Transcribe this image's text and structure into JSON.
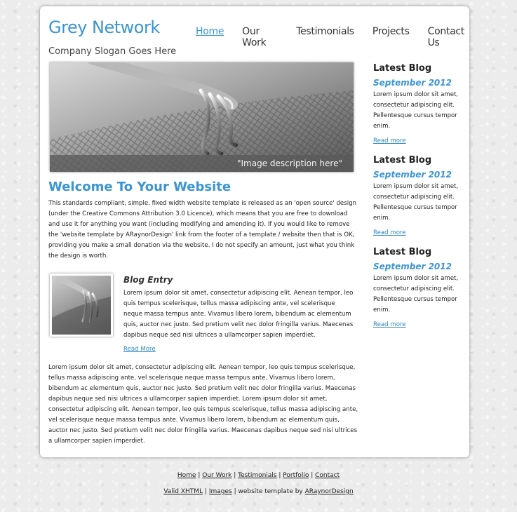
{
  "header": {
    "site_title": "Grey Network",
    "slogan": "Company Slogan Goes Here"
  },
  "nav": {
    "items": [
      {
        "label": "Home",
        "active": true
      },
      {
        "label": "Our Work",
        "active": false
      },
      {
        "label": "Testimonials",
        "active": false
      },
      {
        "label": "Projects",
        "active": false
      },
      {
        "label": "Contact Us",
        "active": false
      }
    ]
  },
  "banner": {
    "caption": "\"Image description here\""
  },
  "main": {
    "welcome_heading": "Welcome To Your Website",
    "intro_text": "This standards compliant, simple, fixed width website template is released as an 'open source' design (under the Creative Commons Attribution 3.0 Licence), which means that you are free to download and use it for anything you want (including modifying and amending it). If you would like to remove the 'website template by ARaynorDesign' link from the footer of a template / website then that is OK, providing you make a small donation via the website. I do not specify an amount, just what you think the design is worth.",
    "blog_entry": {
      "title": "Blog Entry",
      "text": "Lorem ipsum dolor sit amet, consectetur adipiscing elit. Aenean tempor, leo quis tempus scelerisque, tellus massa adipiscing ante, vel scelerisque neque massa tempus ante. Vivamus libero lorem, bibendum ac elementum quis, auctor nec justo. Sed pretium velit nec dolor fringilla varius. Maecenas dapibus neque sed nisi ultrices a ullamcorper sapien imperdiet.",
      "read_more": "Read More"
    },
    "body_text": "Lorem ipsum dolor sit amet, consectetur adipiscing elit. Aenean tempor, leo quis tempus scelerisque, tellus massa adipiscing ante, vel scelerisque neque massa tempus ante. Vivamus libero lorem, bibendum ac elementum quis, auctor nec justo. Sed pretium velit nec dolor fringilla varius. Maecenas dapibus neque sed nisi ultrices a ullamcorper sapien imperdiet. Lorem ipsum dolor sit amet, consectetur adipiscing elit. Aenean tempor, leo quis tempus scelerisque, tellus massa adipiscing ante, vel scelerisque neque massa tempus ante. Vivamus libero lorem, bibendum ac elementum quis, auctor nec justo. Sed pretium velit nec dolor fringilla varius. Maecenas dapibus neque sed nisi ultrices a ullamcorper sapien imperdiet."
  },
  "sidebar": {
    "blocks": [
      {
        "heading": "Latest Blog",
        "date": "September 2012",
        "text": "Lorem ipsum dolor sit amet, consectetur adipiscing elit. Pellentesque cursus tempor enim.",
        "read_more": "Read more"
      },
      {
        "heading": "Latest Blog",
        "date": "September 2012",
        "text": "Lorem ipsum dolor sit amet, consectetur adipiscing elit. Pellentesque cursus tempor enim.",
        "read_more": "Read more"
      },
      {
        "heading": "Latest Blog",
        "date": "September 2012",
        "text": "Lorem ipsum dolor sit amet, consectetur adipiscing elit. Pellentesque cursus tempor enim.",
        "read_more": "Read more"
      }
    ]
  },
  "footer": {
    "links": [
      "Home",
      "Our Work",
      "Testimonials",
      "Portfolio",
      "Contact"
    ],
    "separator": " | ",
    "valid_xhtml": "Valid XHTML",
    "images": "Images",
    "credit_text": " | website template by ",
    "author": "ARaynorDesign"
  },
  "colors": {
    "accent": "#3a95d2",
    "link": "#2e88c5",
    "background": "#ececec"
  }
}
